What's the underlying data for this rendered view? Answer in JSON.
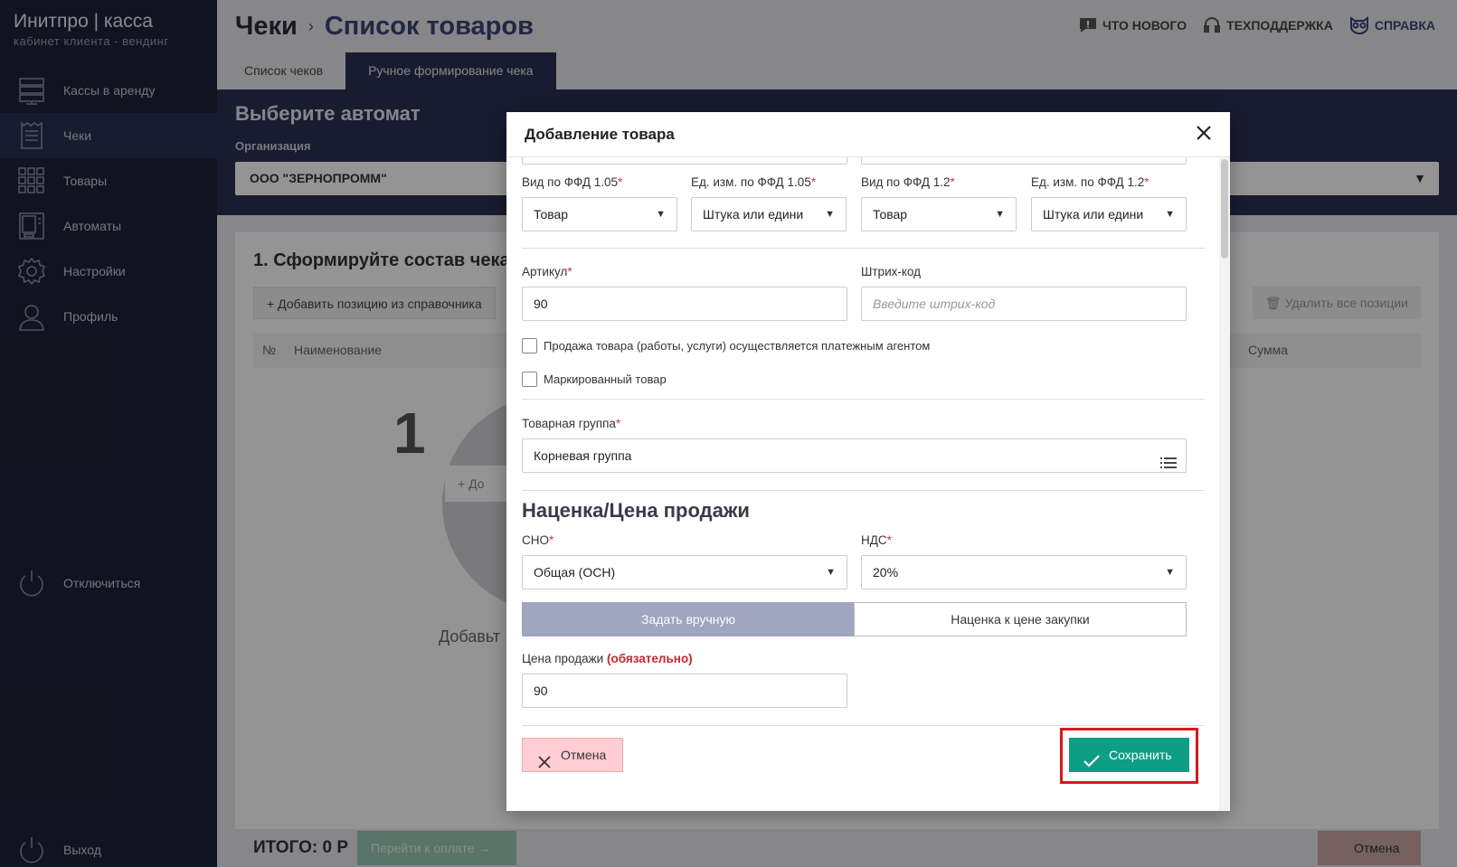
{
  "sidebar": {
    "brand": "Инитпро | касса",
    "subtitle": "кабинет клиента - вендинг",
    "items": [
      {
        "label": "Кассы в аренду",
        "icon": "server-icon"
      },
      {
        "label": "Чеки",
        "icon": "receipt-icon"
      },
      {
        "label": "Товары",
        "icon": "grid-icon"
      },
      {
        "label": "Автоматы",
        "icon": "vending-machine-icon"
      },
      {
        "label": "Настройки",
        "icon": "gear-icon"
      },
      {
        "label": "Профиль",
        "icon": "user-icon"
      }
    ],
    "disconnect": "Отключиться",
    "logout": "Выход"
  },
  "header": {
    "crumb_parent": "Чеки",
    "crumb_current": "Список товаров",
    "links": {
      "whats_new": "ЧТО НОВОГО",
      "support": "ТЕХПОДДЕРЖКА",
      "help": "СПРАВКА"
    }
  },
  "tabs": [
    "Список чеков",
    "Ручное формирование чека"
  ],
  "band": {
    "title": "Выберите автомат",
    "org_label": "Организация",
    "org_value": "ООО \"ЗЕРНОПРОММ\""
  },
  "card": {
    "step_title": "1. Сформируйте состав чека",
    "add_position": "Добавить позицию из справочника",
    "delete_all": "Удалить все позиции",
    "columns": {
      "num": "№",
      "name": "Наименование",
      "sum": "Сумма"
    },
    "big_number": "1",
    "empty_btn": "До",
    "empty_text": "Добавьт"
  },
  "footer": {
    "total": "ИТОГО: 0 Р",
    "pay": "Перейти к оплате",
    "cancel": "Отмена"
  },
  "modal": {
    "title": "Добавление товара",
    "fields": {
      "kind_105": {
        "label": "Вид по ФФД 1.05",
        "value": "Товар"
      },
      "unit_105": {
        "label": "Ед. изм. по ФФД 1.05",
        "value": "Штука или едини"
      },
      "kind_12": {
        "label": "Вид по ФФД 1.2",
        "value": "Товар"
      },
      "unit_12": {
        "label": "Ед. изм. по ФФД 1.2",
        "value": "Штука или едини"
      },
      "article": {
        "label": "Артикул",
        "value": "90"
      },
      "barcode": {
        "label": "Штрих-код",
        "placeholder": "Введите штрих-код"
      },
      "agent_checkbox": "Продажа товара (работы, услуги) осуществляется платежным агентом",
      "marked_checkbox": "Маркированный товар",
      "group": {
        "label": "Товарная группа",
        "value": "Корневая группа"
      }
    },
    "pricing": {
      "title": "Наценка/Цена продажи",
      "sno": {
        "label": "СНО",
        "value": "Общая (ОСН)"
      },
      "vat": {
        "label": "НДС",
        "value": "20%"
      },
      "mode_manual": "Задать вручную",
      "mode_markup": "Наценка к цене закупки",
      "price_label": "Цена продажи",
      "price_note": "(обязательно)",
      "price_value": "90"
    },
    "buttons": {
      "cancel": "Отмена",
      "save": "Сохранить"
    }
  }
}
